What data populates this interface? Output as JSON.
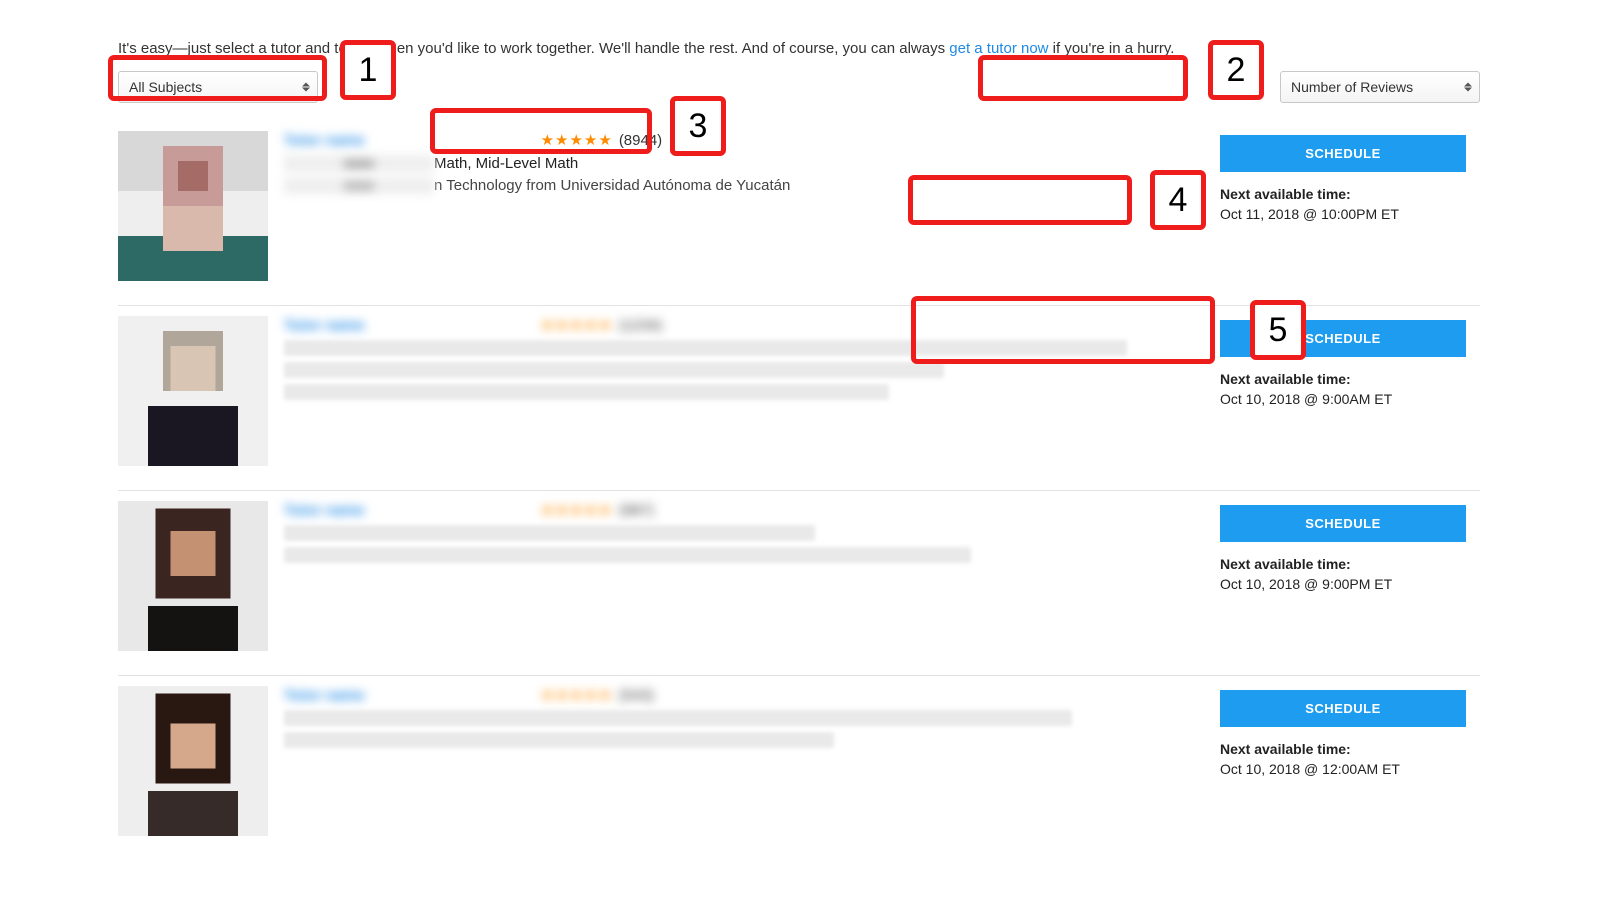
{
  "intro": {
    "prefix": "It's easy—just select a tutor and tell us when you'd like to work together. We'll handle the rest. And of course, you can always ",
    "link_text": "get a tutor now",
    "suffix": " if you're in a hurry."
  },
  "filters": {
    "subject_selected": "All Subjects",
    "sort_selected": "Number of Reviews"
  },
  "tutors": [
    {
      "name": "Tutor name",
      "stars": "★★★★★",
      "review_count": "(8944)",
      "subjects": "Math, Mid-Level Math",
      "bio": "n Technology from Universidad Autónoma de Yucatán",
      "clear_rating": true,
      "avail_label": "Next available time:",
      "avail_time": "Oct 11, 2018 @ 10:00PM ET",
      "schedule_label": "SCHEDULE"
    },
    {
      "name": "Tutor name",
      "stars": "★★★★★",
      "review_count": "(1234)",
      "avail_label": "Next available time:",
      "avail_time": "Oct 10, 2018 @ 9:00AM ET",
      "schedule_label": "SCHEDULE"
    },
    {
      "name": "Tutor name",
      "stars": "★★★★★",
      "review_count": "(987)",
      "avail_label": "Next available time:",
      "avail_time": "Oct 10, 2018 @ 9:00PM ET",
      "schedule_label": "SCHEDULE"
    },
    {
      "name": "Tutor name",
      "stars": "★★★★★",
      "review_count": "(543)",
      "avail_label": "Next available time:",
      "avail_time": "Oct 10, 2018 @ 12:00AM ET",
      "schedule_label": "SCHEDULE"
    }
  ],
  "annotations": {
    "n1": "1",
    "n2": "2",
    "n3": "3",
    "n4": "4",
    "n5": "5"
  }
}
